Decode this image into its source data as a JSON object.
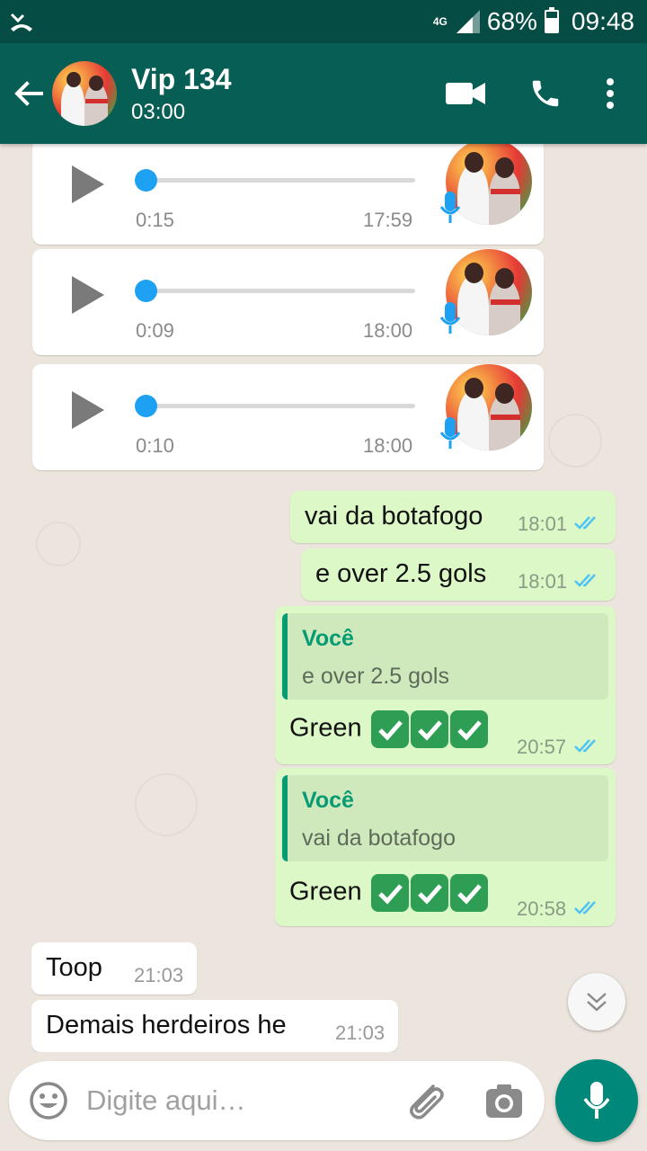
{
  "status_bar": {
    "network_type": "4G",
    "battery_percent": "68%",
    "battery_level": 0.68,
    "time": "09:48"
  },
  "header": {
    "contact_name": "Vip 134",
    "contact_status": "03:00"
  },
  "voice_messages": [
    {
      "duration": "0:15",
      "time": "17:59"
    },
    {
      "duration": "0:09",
      "time": "18:00"
    },
    {
      "duration": "0:10",
      "time": "18:00"
    }
  ],
  "outgoing": [
    {
      "text": "vai da botafogo",
      "time": "18:01"
    },
    {
      "text": "e over 2.5 gols",
      "time": "18:01"
    }
  ],
  "replies": [
    {
      "quote_author": "Você",
      "quote_text": "e over 2.5 gols",
      "text": "Green",
      "time": "20:57"
    },
    {
      "quote_author": "Você",
      "quote_text": "vai da botafogo",
      "text": "Green",
      "time": "20:58"
    }
  ],
  "incoming": [
    {
      "text": "Toop",
      "time": "21:03"
    },
    {
      "text": "Demais herdeiros he",
      "time": "21:03"
    }
  ],
  "composer": {
    "placeholder": "Digite aqui…"
  },
  "colors": {
    "header": "#075e54",
    "status_bar": "#054d44",
    "outgoing_bubble": "#dcf8c6",
    "read_ticks": "#4fc3f7",
    "voice_progress": "#1ea1f2",
    "fab": "#00897b"
  },
  "icons": {
    "back": "arrow-left-icon",
    "video": "video-call-icon",
    "call": "phone-icon",
    "menu": "more-vert-icon",
    "play": "play-icon",
    "mic": "mic-icon",
    "emoji": "emoji-icon",
    "attach": "paperclip-icon",
    "camera": "camera-icon",
    "scroll": "double-chevron-down-icon"
  }
}
